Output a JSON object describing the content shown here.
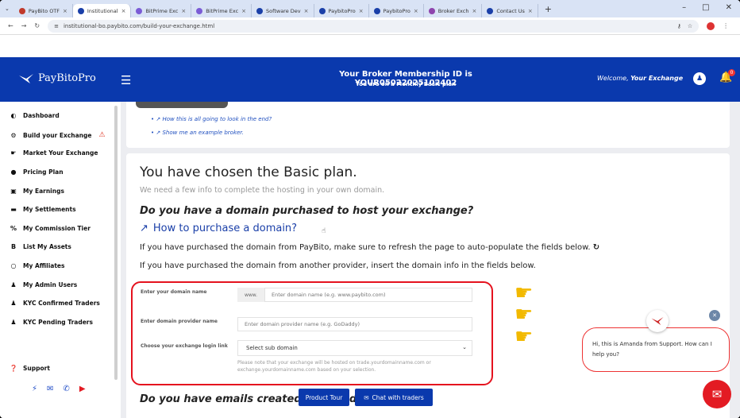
{
  "browser": {
    "tabs": [
      {
        "label": "PayBito OTF",
        "color": "#c0392b",
        "active": false
      },
      {
        "label": "Institutional",
        "color": "#1a3fa8",
        "active": true
      },
      {
        "label": "BitPrime Exc",
        "color": "#7b5cd6",
        "active": false
      },
      {
        "label": "BitPrime Exc",
        "color": "#7b5cd6",
        "active": false
      },
      {
        "label": "Software Dev",
        "color": "#1a3fa8",
        "active": false
      },
      {
        "label": "PaybitoPro",
        "color": "#1a3fa8",
        "active": false
      },
      {
        "label": "PaybitoPro",
        "color": "#1a3fa8",
        "active": false
      },
      {
        "label": "Broker Exch",
        "color": "#8e44ad",
        "active": false
      },
      {
        "label": "Contact Us",
        "color": "#1a3fa8",
        "active": false
      }
    ],
    "new_tab": "+",
    "url": "institutional-bo.paybito.com/build-your-exchange.html"
  },
  "header": {
    "logo": "PayBitoPro",
    "broker_id": "Your Broker Membership ID is YOUR05022025102402",
    "plan_text": "You are on a Monthly Basic plan",
    "welcome_prefix": "Welcome, ",
    "welcome_name": "Your Exchange",
    "notification_count": "0"
  },
  "sidebar": {
    "items": [
      {
        "label": "Dashboard",
        "icon": "dashboard-icon",
        "glyph": "◐"
      },
      {
        "label": "Build your Exchange",
        "icon": "gear-icon",
        "glyph": "⚙"
      },
      {
        "label": "Market Your Exchange",
        "icon": "megaphone-icon",
        "glyph": "☛"
      },
      {
        "label": "Pricing Plan",
        "icon": "tag-icon",
        "glyph": "●"
      },
      {
        "label": "My Earnings",
        "icon": "cash-icon",
        "glyph": "▣"
      },
      {
        "label": "My Settlements",
        "icon": "card-icon",
        "glyph": "▬"
      },
      {
        "label": "My Commission Tier",
        "icon": "percent-icon",
        "glyph": "%"
      },
      {
        "label": "List My Assets",
        "icon": "bitcoin-icon",
        "glyph": "B"
      },
      {
        "label": "My Affiliates",
        "icon": "circle-icon",
        "glyph": "○"
      },
      {
        "label": "My Admin Users",
        "icon": "user-lock-icon",
        "glyph": "♟"
      },
      {
        "label": "KYC Confirmed Traders",
        "icon": "user-icon",
        "glyph": "♟"
      },
      {
        "label": "KYC Pending Traders",
        "icon": "users-icon",
        "glyph": "♟"
      }
    ],
    "support": "Support"
  },
  "top_links": [
    "How this is all going to look in the end?",
    "Show me an example broker."
  ],
  "content": {
    "title": "You have chosen the Basic plan.",
    "subtitle": "We need a few info to complete the hosting in your own domain.",
    "question_domain": "Do you have a domain purchased to host your exchange?",
    "howto_link": "How to purchase a domain?",
    "para_paybito": "If you have purchased the domain from PayBito, make sure to refresh the page to auto-populate the fields below.",
    "para_other": "If you have purchased the domain from another provider, insert the domain info in the fields below.",
    "form": {
      "domain_label": "Enter your domain name",
      "domain_prefix": "www.",
      "domain_placeholder": "Enter domain name (e.g. www.paybito.com)",
      "provider_label": "Enter domain provider name",
      "provider_placeholder": "Enter domain provider name (e.g. GoDaddy)",
      "login_label": "Choose your exchange login link",
      "login_selected": "Select sub domain",
      "note": "Please note that your exchange will be hosted on trade.yourdomainname.com or exchange.yourdomainname.com based on your selection."
    },
    "question_emails": "Do you have emails created fo",
    "question_emails_tail": "d"
  },
  "buttons": {
    "product_tour": "Product Tour",
    "chat_traders": "Chat with traders"
  },
  "support_chat": {
    "message": "Hi, this is Amanda from Support. How can I help you?"
  },
  "colors": {
    "brand_blue": "#0a39ad",
    "highlight_red": "#e5121e",
    "pointer_yellow": "#f2b900"
  }
}
